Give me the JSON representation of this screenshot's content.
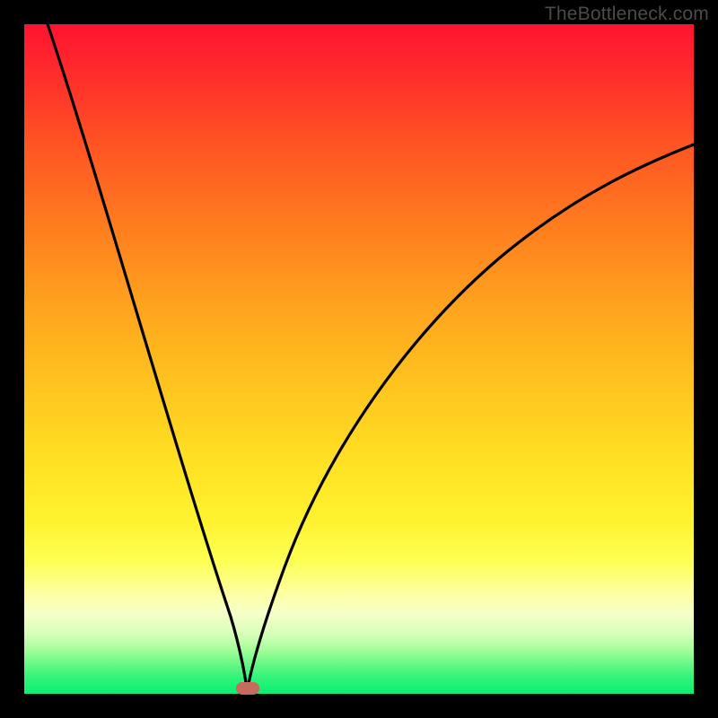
{
  "watermark": "TheBottleneck.com",
  "chart_data": {
    "type": "line",
    "title": "",
    "xlabel": "",
    "ylabel": "",
    "xlim": [
      0,
      1
    ],
    "ylim": [
      0,
      1
    ],
    "background_gradient": {
      "direction": "vertical",
      "stops": [
        {
          "pos": 0.0,
          "color": "#ff1330"
        },
        {
          "pos": 0.8,
          "color": "#feff53"
        },
        {
          "pos": 0.95,
          "color": "#6af885"
        },
        {
          "pos": 1.0,
          "color": "#0bee74"
        }
      ]
    },
    "series": [
      {
        "name": "left_branch",
        "x": [
          0.035,
          0.08,
          0.13,
          0.18,
          0.23,
          0.27,
          0.3,
          0.32,
          0.333
        ],
        "y": [
          1.0,
          0.85,
          0.69,
          0.52,
          0.34,
          0.19,
          0.08,
          0.02,
          0.0
        ]
      },
      {
        "name": "right_branch",
        "x": [
          0.333,
          0.36,
          0.4,
          0.45,
          0.52,
          0.6,
          0.7,
          0.8,
          0.9,
          1.0
        ],
        "y": [
          0.0,
          0.07,
          0.19,
          0.32,
          0.45,
          0.56,
          0.66,
          0.73,
          0.78,
          0.82
        ]
      }
    ],
    "marker": {
      "x": 0.333,
      "y": 0.0,
      "color": "#c76b5f"
    },
    "annotations": []
  }
}
